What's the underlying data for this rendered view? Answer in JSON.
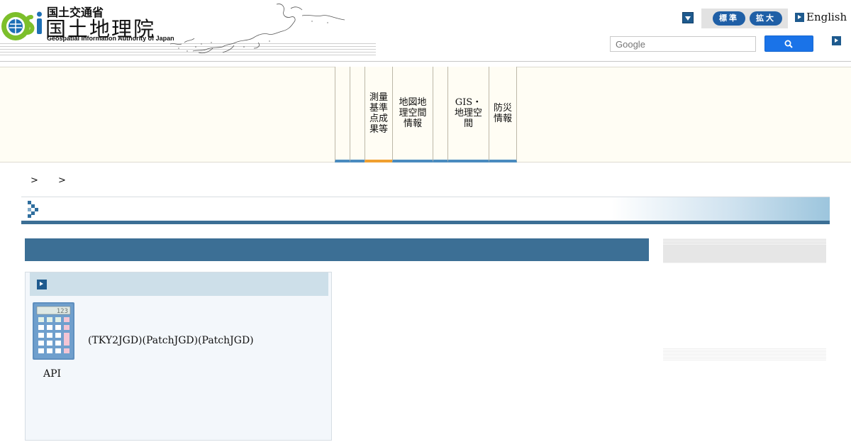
{
  "header": {
    "ministry": "国土交通省",
    "agency_name": "国土地理院",
    "agency_name_en": "Geospatial Information Authority of Japan",
    "logo_mark": "GSI",
    "fontsize": {
      "standard_label": "標準",
      "enlarge_label": "拡大"
    },
    "english_label": "English",
    "search": {
      "placeholder": "Google"
    }
  },
  "nav": {
    "items": [
      {
        "label": ""
      },
      {
        "label": ""
      },
      {
        "label": "測量基準点成果等"
      },
      {
        "label": "地図地理空間情報"
      },
      {
        "label": ""
      },
      {
        "label": "GIS・地理空間"
      },
      {
        "label": "防災情報"
      }
    ],
    "active_index": 2
  },
  "breadcrumb": {
    "separator": ">"
  },
  "card": {
    "text": "(TKY2JGD)(PatchJGD)(PatchJGD)",
    "caption": "API",
    "image": "calculator-icon",
    "image_display": "123"
  },
  "colors": {
    "brand_blue": "#3c6f95",
    "accent_orange": "#f0a030",
    "nav_background": "#fffdf4",
    "search_button": "#1a73e8"
  }
}
